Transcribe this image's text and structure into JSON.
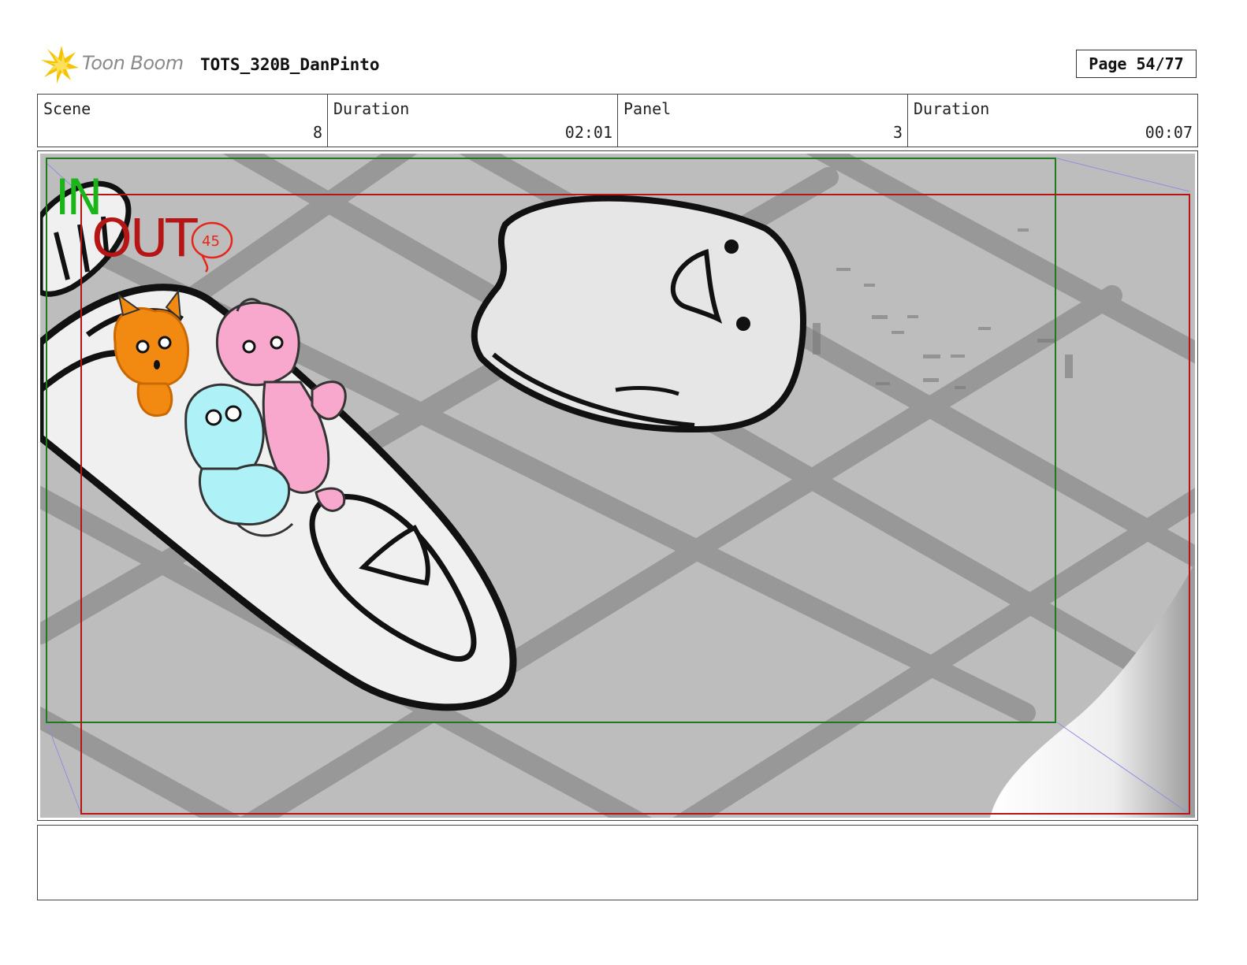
{
  "header": {
    "logo_text": "Toon Boom",
    "document_title": "TOTS_320B_DanPinto",
    "page_label": "Page 54/77"
  },
  "info": {
    "scene_label": "Scene",
    "scene_value": "8",
    "scene_duration_label": "Duration",
    "scene_duration_value": "02:01",
    "panel_label": "Panel",
    "panel_value": "3",
    "panel_duration_label": "Duration",
    "panel_duration_value": "00:07"
  },
  "panel": {
    "in_marker": "IN",
    "out_marker": "OUT",
    "scribble_number": "45"
  },
  "notes": {
    "text": ""
  },
  "colors": {
    "safe_area_green": "#1e7a1e",
    "frame_red": "#b51515",
    "floor_gray": "#bdbdbd",
    "character_orange": "#f28a12",
    "character_pink": "#f7a8cc",
    "character_cyan": "#aef1f7"
  }
}
